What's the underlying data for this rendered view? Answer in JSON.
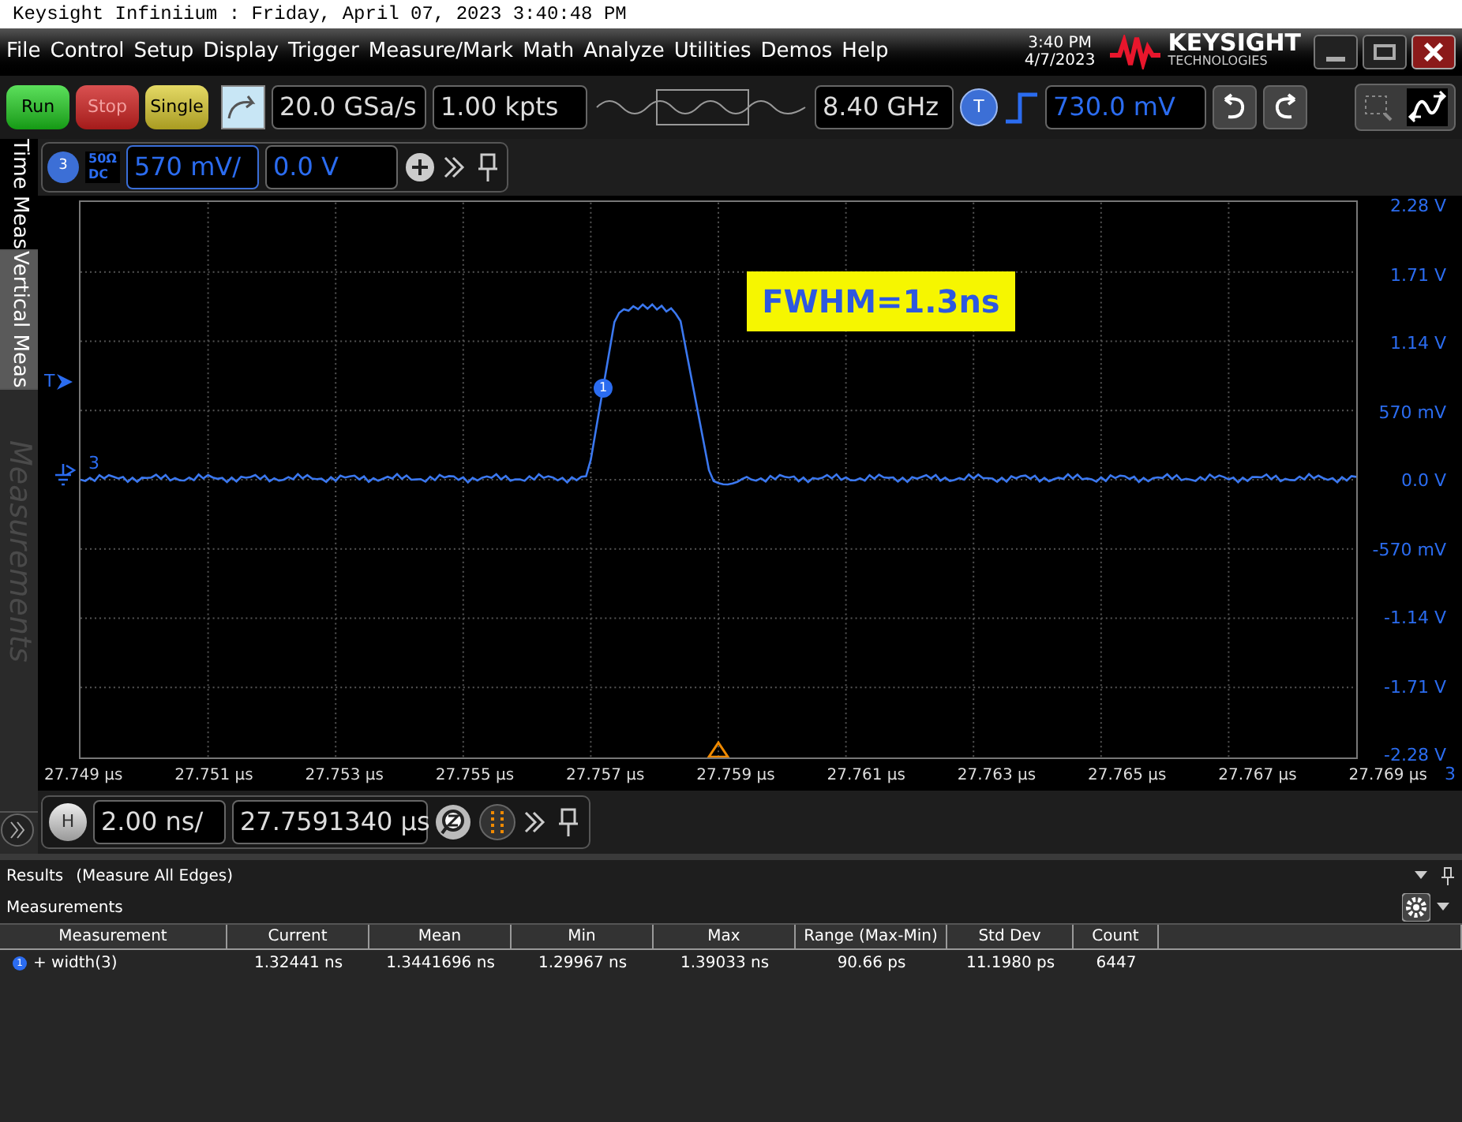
{
  "title_bar": {
    "text": "Keysight Infiniium : Friday, April 07, 2023 3:40:48 PM"
  },
  "menu": [
    "File",
    "Control",
    "Setup",
    "Display",
    "Trigger",
    "Measure/Mark",
    "Math",
    "Analyze",
    "Utilities",
    "Demos",
    "Help"
  ],
  "clock": {
    "time": "3:40 PM",
    "date": "4/7/2023"
  },
  "logo": {
    "name": "KEYSIGHT",
    "subtitle": "TECHNOLOGIES"
  },
  "toolbar": {
    "run_buttons": [
      {
        "label": "Run",
        "kind": "run"
      },
      {
        "label": "Stop",
        "kind": "stop"
      },
      {
        "label": "Single",
        "kind": "single"
      }
    ],
    "sample_rate": "20.0 GSa/s",
    "memory_depth": "1.00 kpts",
    "bandwidth": "8.40 GHz",
    "trigger_badge": "T",
    "trigger_level": "730.0 mV"
  },
  "channel_bar": {
    "channel": "3",
    "impedance": "50Ω",
    "coupling": "DC",
    "scale": "570 mV/",
    "offset": "0.0 V"
  },
  "side_tabs": [
    {
      "label": "Time Meas",
      "selected": true,
      "disabled": false
    },
    {
      "label": "Vertical Meas",
      "selected": false,
      "disabled": false
    },
    {
      "label": "Measurements",
      "selected": false,
      "disabled": true
    }
  ],
  "plot": {
    "annotation": "FWHM=1.3ns",
    "trigger_marker": "T",
    "channel_marker": "3",
    "waveform_marker": "1",
    "y_labels": [
      "2.28 V",
      "1.71 V",
      "1.14 V",
      "570 mV",
      "0.0 V",
      "-570 mV",
      "-1.14 V",
      "-1.71 V",
      "-2.28 V"
    ],
    "x_labels": [
      "27.749 µs",
      "27.751 µs",
      "27.753 µs",
      "27.755 µs",
      "27.757 µs",
      "27.759 µs",
      "27.761 µs",
      "27.763 µs",
      "27.765 µs",
      "27.767 µs",
      "27.769 µs"
    ],
    "channel_tag": "3"
  },
  "horizontal_bar": {
    "badge": "H",
    "scale": "2.00 ns/",
    "position": "27.7591340 µs"
  },
  "results": {
    "title": "Results",
    "subtitle": "(Measure All Edges)",
    "section": "Measurements",
    "columns": [
      "Measurement",
      "Current",
      "Mean",
      "Min",
      "Max",
      "Range (Max-Min)",
      "Std Dev",
      "Count"
    ],
    "rows": [
      {
        "marker": "1",
        "cells": [
          "+ width(3)",
          "1.32441 ns",
          "1.3441696 ns",
          "1.29967 ns",
          "1.39033 ns",
          "90.66 ps",
          "11.1980 ps",
          "6447"
        ]
      }
    ]
  }
}
